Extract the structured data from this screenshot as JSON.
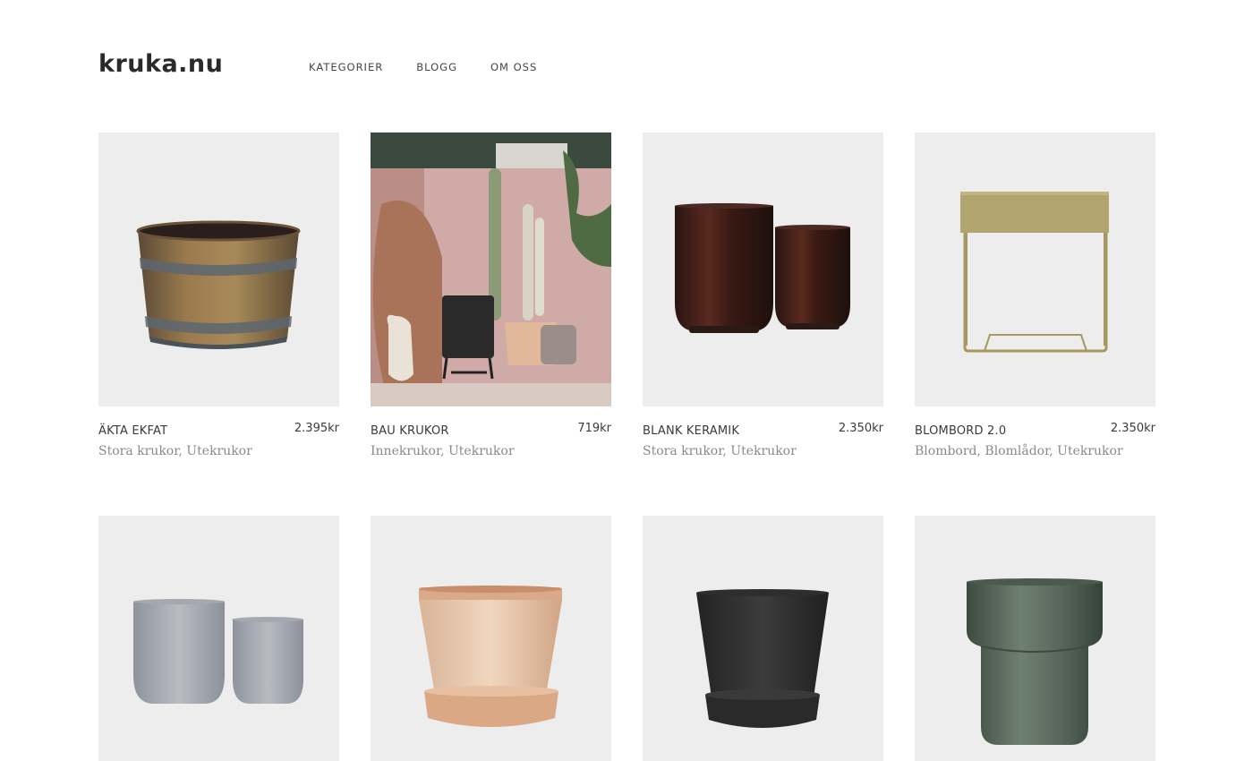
{
  "header": {
    "logo": "kruka.nu",
    "nav": [
      "KATEGORIER",
      "BLOGG",
      "OM OSS"
    ]
  },
  "products": [
    {
      "name": "ÄKTA EKFAT",
      "price": "2.395kr",
      "categories": "Stora krukor, Utekrukor",
      "image": "oak-barrel-planter"
    },
    {
      "name": "BAU KRUKOR",
      "price": "719kr",
      "categories": "Innekrukor, Utekrukor",
      "image": "lifestyle-pots-cacti"
    },
    {
      "name": "BLANK KERAMIK",
      "price": "2.350kr",
      "categories": "Stora krukor, Utekrukor",
      "image": "glossy-brown-ceramic-pots"
    },
    {
      "name": "BLOMBORD 2.0",
      "price": "2.350kr",
      "categories": "Blombord, Blomlådor, Utekrukor",
      "image": "brass-plant-box-stand"
    },
    {
      "name": "",
      "price": "",
      "categories": "",
      "image": "grey-concrete-pots"
    },
    {
      "name": "",
      "price": "",
      "categories": "",
      "image": "terracotta-pot-saucer"
    },
    {
      "name": "",
      "price": "",
      "categories": "",
      "image": "black-pot-saucer"
    },
    {
      "name": "",
      "price": "",
      "categories": "",
      "image": "green-glazed-pot"
    }
  ]
}
